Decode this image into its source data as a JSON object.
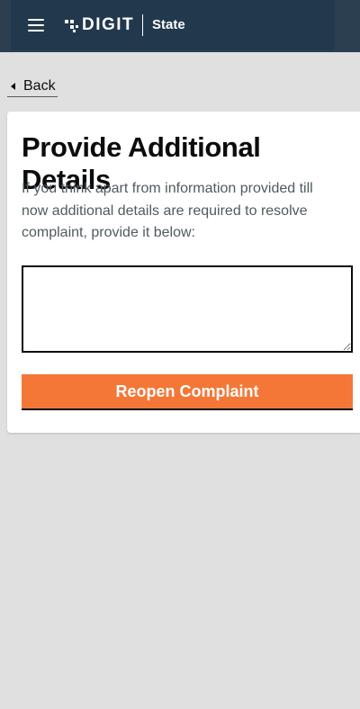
{
  "header": {
    "brand_logo_text": "DIGIT",
    "state_name": "State",
    "background_color": "#22394d"
  },
  "back": {
    "label": "Back"
  },
  "card": {
    "title": "Provide Additional Details",
    "description": "If you think apart from information provided till now additional details are required to resolve complaint, provide it below:",
    "input_value": "",
    "submit_label": "Reopen Complaint",
    "submit_color": "#f47738"
  }
}
